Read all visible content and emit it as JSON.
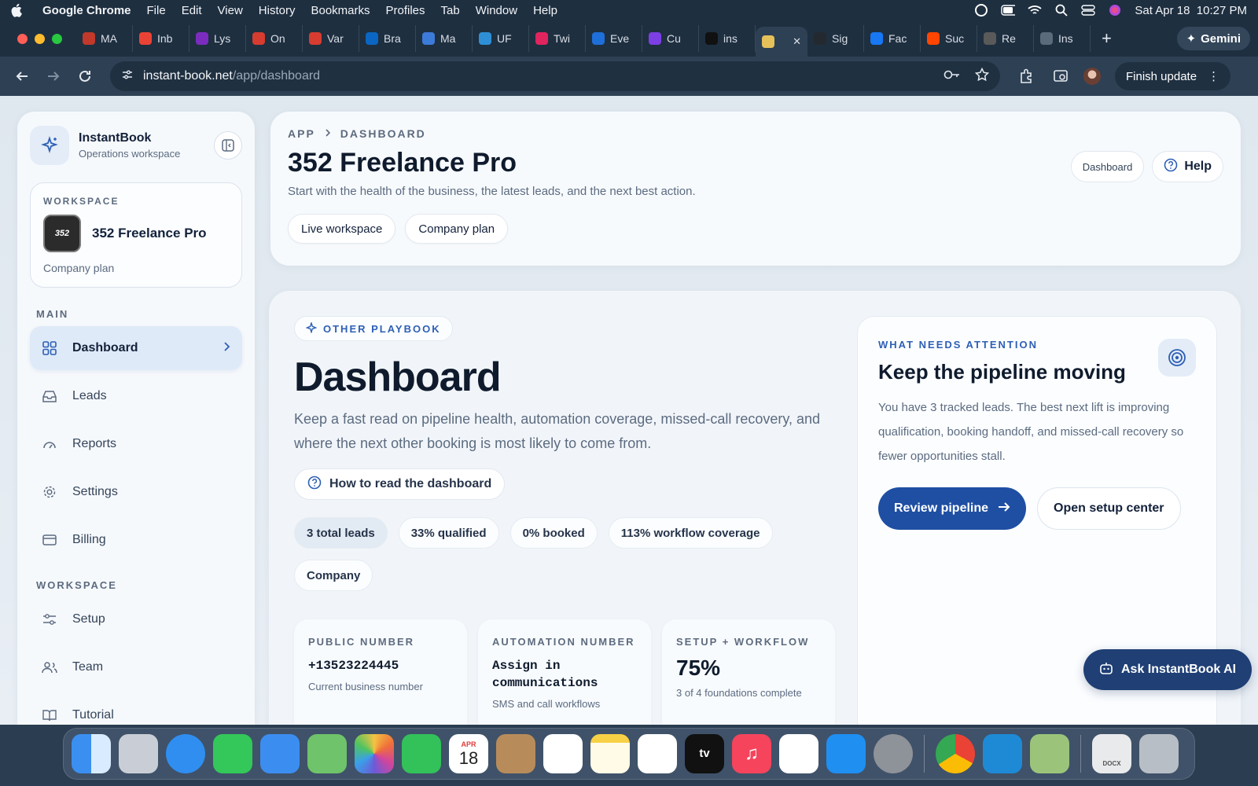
{
  "menubar": {
    "app_name": "Google Chrome",
    "menus": [
      "File",
      "Edit",
      "View",
      "History",
      "Bookmarks",
      "Profiles",
      "Tab",
      "Window",
      "Help"
    ],
    "datetime": "Sat Apr 18  10:27 PM"
  },
  "browser": {
    "tabs": [
      {
        "label": "MA",
        "color": "#c0392b"
      },
      {
        "label": "Inb",
        "color": "#ea4335"
      },
      {
        "label": "Lys",
        "color": "#7b2cbf"
      },
      {
        "label": "On",
        "color": "#d63c2f"
      },
      {
        "label": "Var",
        "color": "#d63c2f"
      },
      {
        "label": "Bra",
        "color": "#0a66c2"
      },
      {
        "label": "Ma",
        "color": "#3d7bd9"
      },
      {
        "label": "UF",
        "color": "#2f8fd6"
      },
      {
        "label": "Twi",
        "color": "#e0245e"
      },
      {
        "label": "Eve",
        "color": "#1e6fd9"
      },
      {
        "label": "Cu",
        "color": "#7b3fe4"
      },
      {
        "label": "ins",
        "color": "#111111"
      },
      {
        "label": "",
        "color": "#e6c15a",
        "active": true
      },
      {
        "label": "Sig",
        "color": "#24292f"
      },
      {
        "label": "Fac",
        "color": "#1877f2"
      },
      {
        "label": "Suc",
        "color": "#ff4500"
      },
      {
        "label": "Re",
        "color": "#5a5a5a"
      },
      {
        "label": "Ins",
        "color": "#5a6b7c"
      }
    ],
    "gemini_label": "Gemini",
    "url_host": "instant-book.net",
    "url_path": "/app/dashboard",
    "finish_update_label": "Finish update"
  },
  "sidebar": {
    "brand_name": "InstantBook",
    "brand_sub": "Operations workspace",
    "workspace_eyebrow": "WORKSPACE",
    "workspace_logo_text": "352",
    "workspace_name": "352 Freelance Pro",
    "workspace_plan": "Company plan",
    "main_label": "MAIN",
    "main_items": [
      {
        "label": "Dashboard",
        "icon": "grid-icon",
        "active": true
      },
      {
        "label": "Leads",
        "icon": "inbox-icon"
      },
      {
        "label": "Reports",
        "icon": "gauge-icon"
      },
      {
        "label": "Settings",
        "icon": "gear-icon"
      },
      {
        "label": "Billing",
        "icon": "card-icon"
      }
    ],
    "workspace_label": "WORKSPACE",
    "workspace_items": [
      {
        "label": "Setup",
        "icon": "sliders-icon"
      },
      {
        "label": "Team",
        "icon": "team-icon"
      },
      {
        "label": "Tutorial",
        "icon": "book-icon"
      }
    ]
  },
  "header": {
    "crumb_1": "APP",
    "crumb_2": "DASHBOARD",
    "title": "352 Freelance Pro",
    "subtitle": "Start with the health of the business, the latest leads, and the next best action.",
    "pill_1": "Live workspace",
    "pill_2": "Company plan",
    "dashboard_btn": "Dashboard",
    "help_btn": "Help"
  },
  "main": {
    "playbook_label": "OTHER PLAYBOOK",
    "title": "Dashboard",
    "subtitle": "Keep a fast read on pipeline health, automation coverage, missed-call recovery, and where the next other booking is most likely to come from.",
    "how_to_label": "How to read the dashboard",
    "stats": [
      "3 total leads",
      "33% qualified",
      "0% booked",
      "113% workflow coverage",
      "Company"
    ],
    "metrics": [
      {
        "label": "PUBLIC NUMBER",
        "value": "+13523224445",
        "note": "Current business number",
        "style": "mono-small"
      },
      {
        "label": "AUTOMATION NUMBER",
        "value": "Assign in communications",
        "note": "SMS and call workflows",
        "style": "mono"
      },
      {
        "label": "SETUP + WORKFLOW",
        "value": "75%",
        "note": "3 of 4 foundations complete",
        "style": "big"
      }
    ]
  },
  "attention": {
    "eyebrow": "WHAT NEEDS ATTENTION",
    "title": "Keep the pipeline moving",
    "body": "You have 3 tracked leads. The best next lift is improving qualification, booking handoff, and missed-call recovery so fewer opportunities stall.",
    "primary_label": "Review pipeline",
    "secondary_label": "Open setup center"
  },
  "ask_ai_label": "Ask InstantBook AI",
  "dock": {
    "calendar_month": "APR",
    "calendar_day": "18",
    "tv_label": "tv",
    "docx_label": "DOCX"
  }
}
